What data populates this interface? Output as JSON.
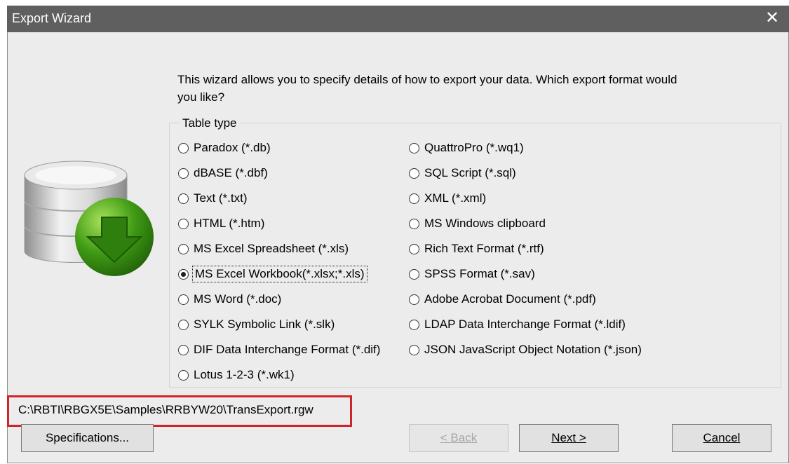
{
  "window": {
    "title": "Export Wizard",
    "close_symbol": "✕"
  },
  "intro": {
    "text": "This wizard allows you to specify details of how to export your data. Which export format would you like?"
  },
  "group": {
    "label": "Table type"
  },
  "options": [
    {
      "label": "Paradox (*.db)",
      "checked": false
    },
    {
      "label": "dBASE (*.dbf)",
      "checked": false
    },
    {
      "label": "Text (*.txt)",
      "checked": false
    },
    {
      "label": "HTML (*.htm)",
      "checked": false
    },
    {
      "label": "MS Excel Spreadsheet (*.xls)",
      "checked": false
    },
    {
      "label": "MS Excel Workbook(*.xlsx;*.xls)",
      "checked": true
    },
    {
      "label": "MS Word (*.doc)",
      "checked": false
    },
    {
      "label": "SYLK Symbolic Link (*.slk)",
      "checked": false
    },
    {
      "label": "DIF Data Interchange Format (*.dif)",
      "checked": false
    },
    {
      "label": "Lotus 1-2-3 (*.wk1)",
      "checked": false
    },
    {
      "label": "QuattroPro (*.wq1)",
      "checked": false
    },
    {
      "label": "SQL Script (*.sql)",
      "checked": false
    },
    {
      "label": "XML (*.xml)",
      "checked": false
    },
    {
      "label": "MS Windows clipboard",
      "checked": false
    },
    {
      "label": "Rich Text Format (*.rtf)",
      "checked": false
    },
    {
      "label": "SPSS Format (*.sav)",
      "checked": false
    },
    {
      "label": "Adobe Acrobat Document (*.pdf)",
      "checked": false
    },
    {
      "label": "LDAP Data Interchange Format (*.ldif)",
      "checked": false
    },
    {
      "label": "JSON JavaScript Object Notation (*.json)",
      "checked": false
    }
  ],
  "file_path": "C:\\RBTI\\RBGX5E\\Samples\\RRBYW20\\TransExport.rgw",
  "buttons": {
    "specifications": "Specifications...",
    "back": "< Back",
    "next": "Next >",
    "cancel": "Cancel"
  },
  "colors": {
    "titlebar": "#5f5f5f",
    "highlight": "#d1232a",
    "icon_green": "#4fae20"
  }
}
